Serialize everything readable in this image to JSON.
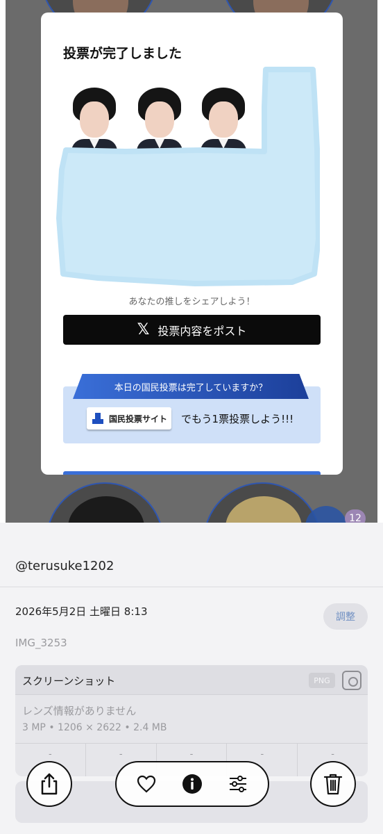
{
  "modal": {
    "title": "投票が完了しました",
    "share_note": "あなたの推しをシェアしよう！",
    "post_button": "投票内容をポスト",
    "ribbon": "本日の国民投票は完了していますか？",
    "site_button": "国民投票サイト",
    "vote_again": "でもう1票投票しよう!!!"
  },
  "background": {
    "badge_count": "12"
  },
  "info": {
    "username": "@terusuke1202",
    "datetime": "2026年5月2日 土曜日 8:13",
    "adjust_button": "調整",
    "filename": "IMG_3253",
    "type_label": "スクリーンショット",
    "format_tag": "PNG",
    "lens_info": "レンズ情報がありません",
    "specs": "3 MP • 1206 × 2622 • 2.4 MB",
    "exif": [
      "-",
      "-",
      "-",
      "-",
      "-"
    ]
  },
  "toolbar": {
    "icons": [
      "share-icon",
      "heart-icon",
      "info-icon",
      "adjust-icon",
      "trash-icon"
    ]
  }
}
